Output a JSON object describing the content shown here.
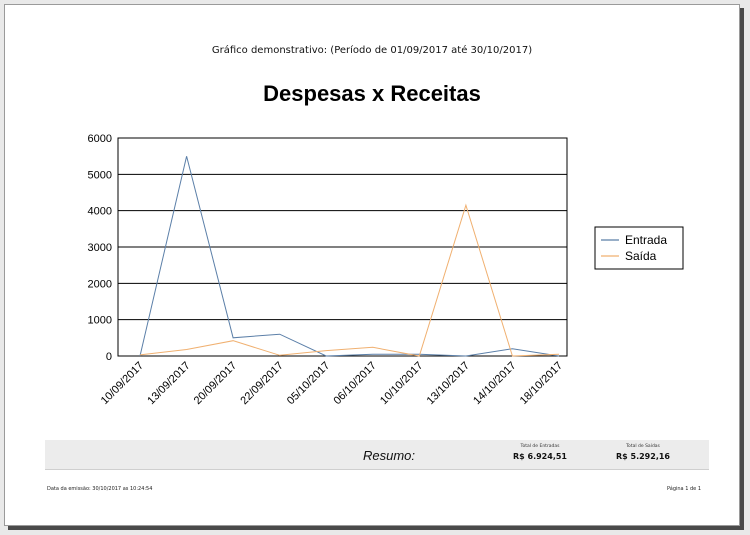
{
  "report": {
    "subtitle": "Gráfico demonstrativo: (Período de 01/09/2017 até 30/10/2017)",
    "title": "Despesas x Receitas"
  },
  "summary": {
    "label": "Resumo:",
    "entradas_label": "Total de Entradas",
    "entradas_value": "R$ 6.924,51",
    "saidas_label": "Total de Saídas",
    "saidas_value": "R$ 5.292,16"
  },
  "footer": {
    "emission": "Data da emissão: 30/10/2017 as 10:24:54",
    "page": "Página 1 de 1"
  },
  "chart_data": {
    "type": "line",
    "categories": [
      "10/09/2017",
      "13/09/2017",
      "20/09/2017",
      "22/09/2017",
      "05/10/2017",
      "06/10/2017",
      "10/10/2017",
      "13/10/2017",
      "14/10/2017",
      "18/10/2017"
    ],
    "ylim": [
      0,
      6000
    ],
    "yticks": [
      0,
      1000,
      2000,
      3000,
      4000,
      5000,
      6000
    ],
    "grid": true,
    "legend_position": "right",
    "series": [
      {
        "name": "Entrada",
        "color": "#5b7fa8",
        "values": [
          0,
          5500,
          500,
          600,
          0,
          50,
          50,
          0,
          200,
          0
        ]
      },
      {
        "name": "Saída",
        "color": "#f0b070",
        "values": [
          30,
          180,
          420,
          20,
          150,
          240,
          0,
          4150,
          0,
          50
        ]
      }
    ]
  }
}
